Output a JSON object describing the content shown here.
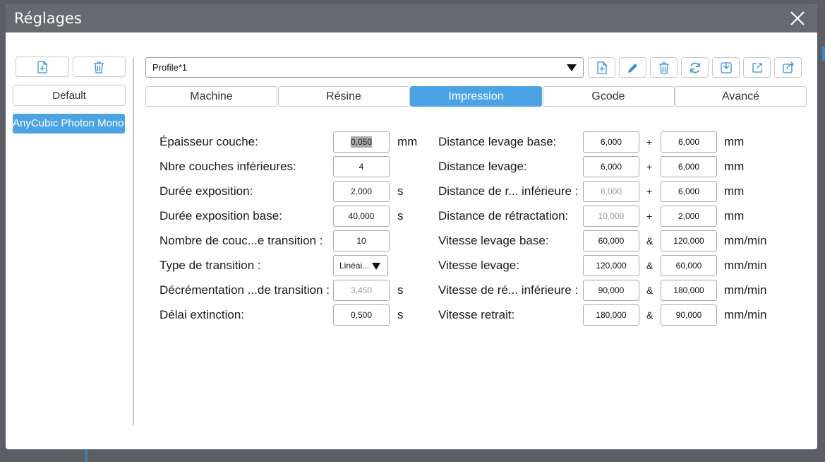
{
  "window": {
    "title": "Réglages"
  },
  "left": {
    "default_label": "Default",
    "profile_item": "AnyCubic Photon Mono X"
  },
  "toolbar": {
    "profile_value": "Profile*1"
  },
  "tabs": [
    "Machine",
    "Résine",
    "Impression",
    "Gcode",
    "Avancé"
  ],
  "active_tab": "Impression",
  "left_fields": [
    {
      "label": "Épaisseur couche:",
      "value": "0,050",
      "unit": "mm"
    },
    {
      "label": "Nbre couches inférieures:",
      "value": "4",
      "unit": ""
    },
    {
      "label": "Durée exposition:",
      "value": "2,000",
      "unit": "s"
    },
    {
      "label": "Durée exposition base:",
      "value": "40,000",
      "unit": "s"
    },
    {
      "label": "Nombre de couc...e transition :",
      "value": "10",
      "unit": ""
    },
    {
      "label": "Type de transition :",
      "value": "Linéai...",
      "unit": ""
    },
    {
      "label": "Décrémentation ...de transition :",
      "value": "3,450",
      "unit": "s"
    },
    {
      "label": "Délai extinction:",
      "value": "0,500",
      "unit": "s"
    }
  ],
  "right_fields": [
    {
      "label": "Distance levage base:",
      "v1": "6,000",
      "sym": "+",
      "v2": "6,000",
      "unit": "mm"
    },
    {
      "label": "Distance levage:",
      "v1": "6,000",
      "sym": "+",
      "v2": "6,000",
      "unit": "mm"
    },
    {
      "label": "Distance de r... inférieure :",
      "v1": "6,000",
      "sym": "+",
      "v2": "6,000",
      "unit": "mm"
    },
    {
      "label": "Distance de rétractation:",
      "v1": "10,000",
      "sym": "+",
      "v2": "2,000",
      "unit": "mm"
    },
    {
      "label": "Vitesse levage base:",
      "v1": "60,000",
      "sym": "&",
      "v2": "120,000",
      "unit": "mm/min"
    },
    {
      "label": "Vitesse levage:",
      "v1": "120,000",
      "sym": "&",
      "v2": "60,000",
      "unit": "mm/min"
    },
    {
      "label": "Vitesse de ré... inférieure :",
      "v1": "90,000",
      "sym": "&",
      "v2": "180,000",
      "unit": "mm/min"
    },
    {
      "label": "Vitesse retrait:",
      "v1": "180,000",
      "sym": "&",
      "v2": "90,000",
      "unit": "mm/min"
    }
  ],
  "colors": {
    "accent": "#4ba3e3",
    "titlebar": "#66696e"
  }
}
